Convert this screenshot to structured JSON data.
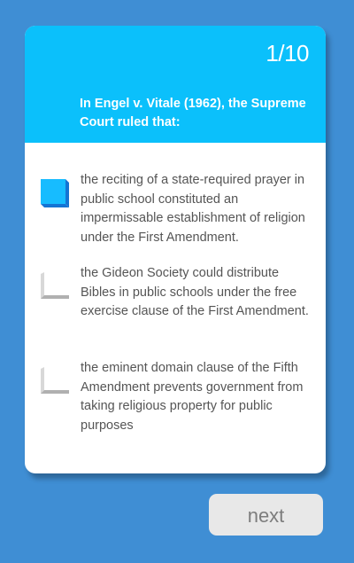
{
  "quiz": {
    "counter": "1/10",
    "question": "In Engel v. Vitale (1962), the Supreme Court ruled that:",
    "options": [
      {
        "text": "the reciting of a state-required prayer in public school constituted an impermissable establishment of religion under the First Amendment.",
        "selected": true
      },
      {
        "text": "the Gideon Society could distribute Bibles in public schools under the free exercise clause of the First Amendment.",
        "selected": false
      },
      {
        "text": "the eminent domain clause of the Fifth Amendment prevents government from taking religious property for public purposes",
        "selected": false
      }
    ],
    "next_label": "next"
  },
  "colors": {
    "background": "#3f8ed4",
    "header": "#0bc0fb",
    "selected_marker": "#17bcff",
    "selected_marker_shade": "#1474d4",
    "unselected_marker": "#b0b0b0",
    "unselected_marker_shade": "#d8d8d8",
    "option_text": "#555555",
    "next_button": "#e8e8e8"
  }
}
